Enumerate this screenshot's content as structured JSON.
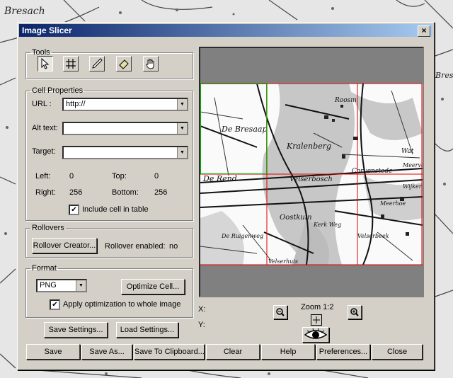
{
  "background_map": {
    "labels": [
      "Bresach",
      "Bres"
    ]
  },
  "dialog": {
    "title": "Image Slicer",
    "close_glyph": "×"
  },
  "tools": {
    "legend": "Tools",
    "items": [
      {
        "name": "pointer-tool",
        "icon": "arrow-pointer-icon",
        "active": true
      },
      {
        "name": "slice-grid-tool",
        "icon": "grid-icon",
        "active": false
      },
      {
        "name": "pen-tool",
        "icon": "pen-icon",
        "active": false
      },
      {
        "name": "eraser-tool",
        "icon": "eraser-icon",
        "active": false
      },
      {
        "name": "hand-tool",
        "icon": "hand-icon",
        "active": false
      }
    ]
  },
  "cell_properties": {
    "legend": "Cell Properties",
    "url_label": "URL :",
    "url_value": "http://",
    "alt_label": "Alt text:",
    "alt_value": "",
    "target_label": "Target:",
    "target_value": "",
    "left_label": "Left:",
    "left_value": "0",
    "top_label": "Top:",
    "top_value": "0",
    "right_label": "Right:",
    "right_value": "256",
    "bottom_label": "Bottom:",
    "bottom_value": "256",
    "include_label": "Include cell in table",
    "include_checked": true
  },
  "rollovers": {
    "legend": "Rollovers",
    "creator_button": "Rollover Creator...",
    "enabled_label": "Rollover enabled:",
    "enabled_value": "no"
  },
  "format": {
    "legend": "Format",
    "selected": "PNG",
    "optimize_button": "Optimize Cell...",
    "apply_label": "Apply optimization to whole image",
    "apply_checked": true
  },
  "settings": {
    "save_button": "Save Settings...",
    "load_button": "Load Settings..."
  },
  "preview": {
    "map_labels": [
      "De Bresaap",
      "Kralenberg",
      "Roosm",
      "Wat",
      "Corvenstede",
      "Meervd",
      "De Rend",
      "Velserbosch",
      "Meerhoe",
      "Wijker",
      "Oostkuin",
      "Kerk Weg",
      "Velserbeek",
      "De Ruigenweg",
      "Velserhuis"
    ],
    "x_label": "X:",
    "y_label": "Y:",
    "zoom_label": "Zoom 1:2"
  },
  "bottom_buttons": {
    "save": "Save",
    "save_as": "Save As...",
    "save_clipboard": "Save To Clipboard...",
    "clear": "Clear",
    "help": "Help",
    "preferences": "Preferences...",
    "close": "Close"
  },
  "colors": {
    "titlebar_start": "#0a246a",
    "titlebar_end": "#a6caf0",
    "dialog_face": "#d4d0c8",
    "slice_red": "#e00000",
    "slice_green": "#00c000"
  }
}
